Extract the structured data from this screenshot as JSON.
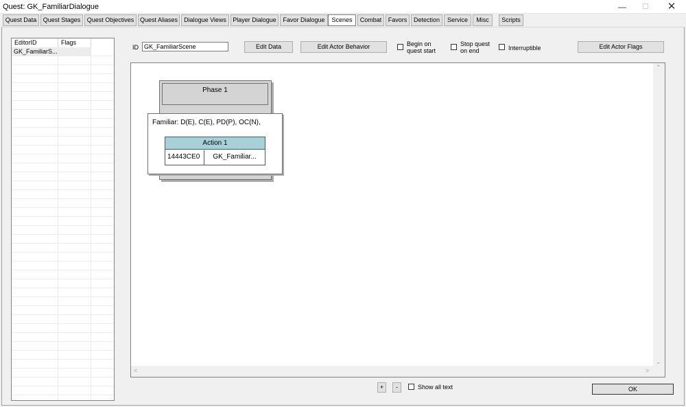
{
  "window": {
    "title": "Quest: GK_FamiliarDialogue",
    "minimize": "—",
    "maximize": "☐",
    "close": "✕"
  },
  "tabs": [
    {
      "label": "Quest Data"
    },
    {
      "label": "Quest Stages"
    },
    {
      "label": "Quest Objectives"
    },
    {
      "label": "Quest Aliases"
    },
    {
      "label": "Dialogue Views"
    },
    {
      "label": "Player Dialogue"
    },
    {
      "label": "Favor Dialogue"
    },
    {
      "label": "Scenes",
      "active": true
    },
    {
      "label": "Combat"
    },
    {
      "label": "Favors"
    },
    {
      "label": "Detection"
    },
    {
      "label": "Service"
    },
    {
      "label": "Misc"
    },
    {
      "label": "Scripts"
    }
  ],
  "scene_list": {
    "columns": [
      "EditorID",
      "Flags",
      ""
    ],
    "rows": [
      {
        "editor_id": "GK_FamiliarS...",
        "flags": ""
      }
    ]
  },
  "controls": {
    "id_label": "ID",
    "id_value": "GK_FamiliarScene",
    "edit_data": "Edit Data",
    "edit_actor_behavior": "Edit Actor Behavior",
    "begin_on_quest_start_1": "Begin on",
    "begin_on_quest_start_2": "quest start",
    "stop_quest_on_end_1": "Stop quest",
    "stop_quest_on_end_2": "on end",
    "interruptible": "Interruptible",
    "edit_actor_flags": "Edit Actor Flags"
  },
  "scene_canvas": {
    "phase_title": "Phase 1",
    "actor_line": "Familiar: D(E), C(E), PD(P), OC(N),",
    "action_title": "Action 1",
    "action_id": "14443CE0",
    "action_target": "GK_Familiar..."
  },
  "footer": {
    "add": "+",
    "remove": "-",
    "show_all_text": "Show all text",
    "ok": "OK"
  },
  "colors": {
    "action_header": "#a8d0d8",
    "phase_fill": "#d4d4d4"
  }
}
